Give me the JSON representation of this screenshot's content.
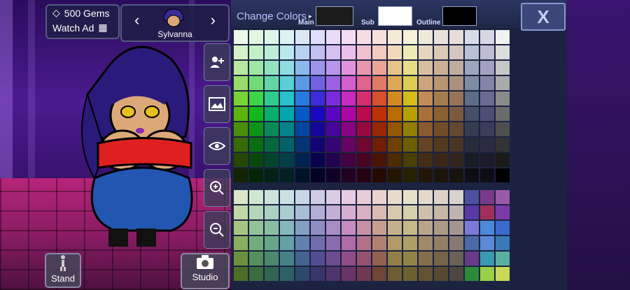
{
  "hud": {
    "gems_label": "500 Gems",
    "watch_ad_label": "Watch Ad",
    "character_name": "Sylvanna",
    "stand_label": "Stand",
    "studio_label": "Studio"
  },
  "colors_panel": {
    "title": "Change Colors",
    "main_label": "Main",
    "sub_label": "Sub",
    "outline_label": "Outline",
    "close_label": "X",
    "main_color": "#1b1b1b",
    "sub_color": "#ffffff",
    "outline_color": "#000000"
  },
  "palette_upper_rows": [
    [
      "#eef6e8",
      "#e3f6e2",
      "#def5ea",
      "#dcf3f4",
      "#dce7f6",
      "#e0ddf6",
      "#eadcf6",
      "#f4dcf1",
      "#f7dde3",
      "#f6e1dc",
      "#f5ebd9",
      "#f6f2d9",
      "#f1e8dc",
      "#eae2d8",
      "#e6ded8",
      "#d7dce6",
      "#d8d8e4",
      "#f1f1f1"
    ],
    [
      "#d6f0c5",
      "#c4f0c8",
      "#bdecd8",
      "#b9e9ec",
      "#b9d1f0",
      "#c4bff0",
      "#d7bff0",
      "#ecbfe9",
      "#f2c1cf",
      "#f1c9bf",
      "#f0d9b8",
      "#eeeab6",
      "#e6d6c0",
      "#dccab7",
      "#d3c6be",
      "#b8c1d3",
      "#bdbdd4",
      "#dcdcdc"
    ],
    [
      "#b9e79e",
      "#9fe7a4",
      "#93e2c0",
      "#8edde2",
      "#8eb7eb",
      "#9e95ea",
      "#bb95ea",
      "#e194dc",
      "#ea97ae",
      "#e9a596",
      "#e8c288",
      "#e6de86",
      "#d9c0a0",
      "#cab196",
      "#bfae9f",
      "#9ba7bc",
      "#a2a2c0",
      "#c6c6c6"
    ],
    [
      "#98dd6b",
      "#6fdc78",
      "#62d6a6",
      "#5ccfd5",
      "#5c99e4",
      "#7061e2",
      "#9b61e2",
      "#d460cc",
      "#e1648c",
      "#e07a62",
      "#dfa653",
      "#dccd50",
      "#cda57c",
      "#b79671",
      "#aa917e",
      "#7f8ba3",
      "#8585aa",
      "#aaaaaa"
    ],
    [
      "#78d335",
      "#3dd447",
      "#2fcb8a",
      "#28c2ca",
      "#2a7ade",
      "#3d2bdc",
      "#7a2bdc",
      "#c92abf",
      "#d82e6b",
      "#d7502c",
      "#d6891f",
      "#d2bb1a",
      "#c38c56",
      "#a57c4c",
      "#977459",
      "#5f6c86",
      "#6a6a92",
      "#8a8a8a"
    ],
    [
      "#5db40f",
      "#12b81d",
      "#0aae6b",
      "#04a5ad",
      "#0658c5",
      "#1b07c1",
      "#5b07c1",
      "#ad06a3",
      "#bd0a4d",
      "#bc3206",
      "#bb6c00",
      "#b8a000",
      "#a9703a",
      "#8c6132",
      "#7c5a3f",
      "#454f67",
      "#4e4e75",
      "#6b6b6b"
    ],
    [
      "#4a8f0b",
      "#0e9217",
      "#078a55",
      "#03838a",
      "#04469e",
      "#15059a",
      "#48059a",
      "#8a0482",
      "#97083d",
      "#962805",
      "#955600",
      "#927f00",
      "#885a2e",
      "#704d28",
      "#634832",
      "#353d50",
      "#3b3b5a",
      "#4e4e4e"
    ],
    [
      "#376b08",
      "#0a6d11",
      "#056740",
      "#026267",
      "#033476",
      "#100474",
      "#360474",
      "#670361",
      "#71062e",
      "#701e04",
      "#704000",
      "#6d5f00",
      "#664322",
      "#543a1e",
      "#4a3625",
      "#262c3a",
      "#2a2a41",
      "#333333"
    ],
    [
      "#254805",
      "#07490b",
      "#03452b",
      "#014145",
      "#02234f",
      "#0b024d",
      "#24024d",
      "#450241",
      "#4b041f",
      "#4b1403",
      "#4b2b00",
      "#493f00",
      "#442d17",
      "#382714",
      "#312419",
      "#181c25",
      "#1b1b2a",
      "#1a1a1a"
    ],
    [
      "#132403",
      "#032506",
      "#022215",
      "#012123",
      "#011228",
      "#050127",
      "#120127",
      "#220121",
      "#260210",
      "#250a01",
      "#251500",
      "#242000",
      "#221609",
      "#1c130a",
      "#18120c",
      "#0c0e12",
      "#0d0d15",
      "#000000"
    ]
  ],
  "palette_lower_rows": [
    [
      "#d9e6c8",
      "#cfe6d0",
      "#cbe3da",
      "#c9e1e3",
      "#c9d6e6",
      "#cfcce6",
      "#dbcce6",
      "#e6cce3",
      "#e8cdd7",
      "#e8d3cd",
      "#e7dccb",
      "#e6e2ca",
      "#e2d8cc",
      "#ddd2c5",
      "#d8d2cc",
      "#4f4fa0",
      "#7a3a8a",
      "#9a5aa8"
    ],
    [
      "#c2d6a6",
      "#b3d6b6",
      "#acd1c1",
      "#a9cdd1",
      "#a9bcd6",
      "#b3aed6",
      "#c4aed6",
      "#d6aed2",
      "#dab1c0",
      "#d9bbb1",
      "#d8c8ad",
      "#d6d0ab",
      "#cfc0ae",
      "#c7b8a6",
      "#beb5ae",
      "#5a3aa8",
      "#a0305a",
      "#7a3aa8"
    ],
    [
      "#a8c483",
      "#92c497",
      "#89bda4",
      "#84b8bd",
      "#849fc4",
      "#928cc4",
      "#a98cc4",
      "#c48cbf",
      "#c890a5",
      "#c89e90",
      "#c6b28a",
      "#c4b987",
      "#b9a48c",
      "#ad9a85",
      "#a2968e",
      "#7a7ad8",
      "#4a8ad8",
      "#3a6ad0"
    ],
    [
      "#8aae60",
      "#72ae79",
      "#68a68a",
      "#63a1a7",
      "#6381ae",
      "#726bae",
      "#8c6bae",
      "#ae6ba8",
      "#b3708b",
      "#b2806f",
      "#b09a68",
      "#ae9f65",
      "#a08a6c",
      "#927f66",
      "#867b72",
      "#4a6aa8",
      "#5a8ad8",
      "#3a7ab8"
    ],
    [
      "#6c9040",
      "#549059",
      "#4b886d",
      "#458288",
      "#456390",
      "#544c90",
      "#6f4c90",
      "#904c89",
      "#95526e",
      "#946150",
      "#927e49",
      "#908347",
      "#836e4e",
      "#766449",
      "#6a6157",
      "#6a3a8a",
      "#3a9ab0",
      "#5ab0a0"
    ],
    [
      "#4d6c28",
      "#3a6c3f",
      "#326551",
      "#2e6165",
      "#2e476c",
      "#3a346c",
      "#50346c",
      "#6c3466",
      "#703951",
      "#6f4536",
      "#6d5d31",
      "#6b612f",
      "#625135",
      "#574a32",
      "#4e473f",
      "#2a8a3a",
      "#9ad048",
      "#c8d858"
    ]
  ]
}
